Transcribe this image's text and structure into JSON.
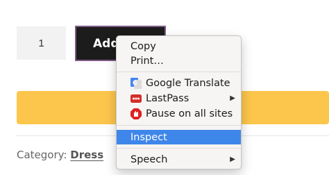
{
  "product": {
    "quantity_value": "1",
    "add_button_label": "Add",
    "category_label": "Category:",
    "category_link": "Dress"
  },
  "context_menu": {
    "copy": "Copy",
    "print": "Print…",
    "extensions": [
      {
        "label": "Google Translate",
        "icon": "google-translate-icon"
      },
      {
        "label": "LastPass",
        "icon": "lastpass-icon",
        "has_submenu": true
      },
      {
        "label": "Pause on all sites",
        "icon": "pause-hand-icon"
      }
    ],
    "inspect": "Inspect",
    "speech": "Speech",
    "submenu_arrow": "▶"
  },
  "colors": {
    "button_bg": "#1c1c1c",
    "button_border": "#7e5a87",
    "yellow_bar": "#fcc64d",
    "menu_highlight": "#3f86ea"
  }
}
